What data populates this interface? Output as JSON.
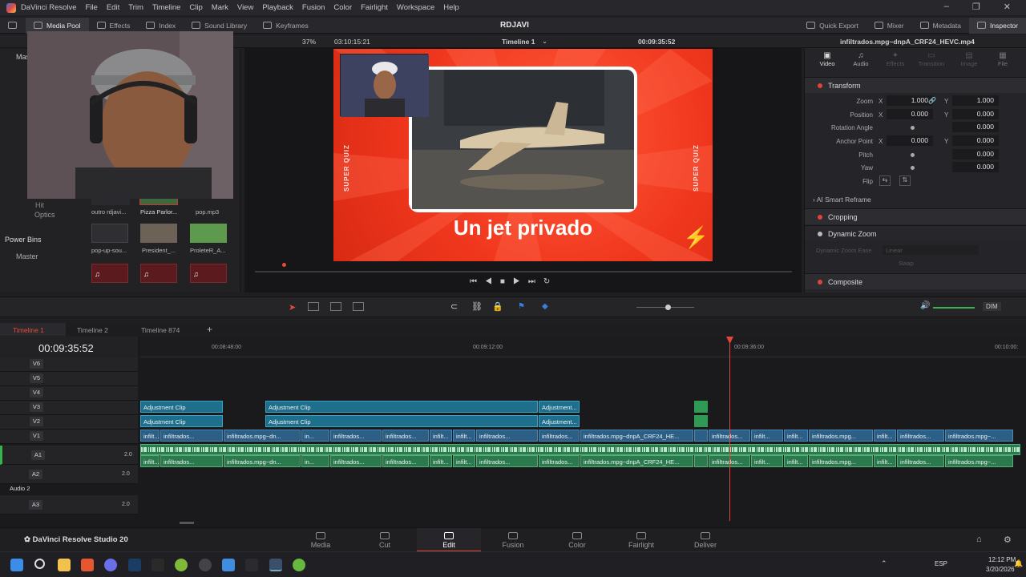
{
  "app": {
    "menu": [
      "DaVinci Resolve",
      "File",
      "Edit",
      "Trim",
      "Timeline",
      "Clip",
      "Mark",
      "View",
      "Playback",
      "Fusion",
      "Color",
      "Fairlight",
      "Workspace",
      "Help"
    ],
    "project_title": "RDJAVI"
  },
  "toolbar": {
    "left": [
      "Media Pool",
      "Effects",
      "Index",
      "Sound Library",
      "Keyframes"
    ],
    "right": [
      "Quick Export",
      "Mixer",
      "Metadata",
      "Inspector"
    ]
  },
  "viewer": {
    "zoom": "37%",
    "source_tc": "03:10:15:21",
    "timeline_name": "Timeline 1",
    "record_tc": "00:09:35:52",
    "frame_side_text": "SUPER QUIZ",
    "frame_caption": "Un jet privado"
  },
  "media_pool": {
    "sidebar": [
      "Hit",
      "Optics"
    ],
    "power_bins_label": "Power Bins",
    "master_label": "Master",
    "clips": [
      "outro rdjavi...",
      "Pizza Parlor...",
      "pop.mp3",
      "pop-up-sou...",
      "President_...",
      "ProleteR_A..."
    ]
  },
  "inspector": {
    "clip_name": "infiltrados.mpg~dnpA_CRF24_HEVC.mp4",
    "tabs": [
      "Video",
      "Audio",
      "Effects",
      "Transition",
      "Image",
      "File"
    ],
    "transform_label": "Transform",
    "params": [
      {
        "label": "Zoom",
        "x": "1.000",
        "y": "1.000"
      },
      {
        "label": "Position",
        "x": "0.000",
        "y": "0.000"
      },
      {
        "label": "Rotation Angle",
        "v": "0.000"
      },
      {
        "label": "Anchor Point",
        "x": "0.000",
        "y": "0.000"
      },
      {
        "label": "Pitch",
        "v": "0.000"
      },
      {
        "label": "Yaw",
        "v": "0.000"
      },
      {
        "label": "Flip"
      }
    ],
    "ai_reframe": "AI Smart Reframe",
    "cropping": "Cropping",
    "dynamic_zoom": "Dynamic Zoom",
    "dz_ease_label": "Dynamic Zoom Ease",
    "dz_ease_value": "Linear",
    "swap": "Swap",
    "composite": "Composite"
  },
  "timeline": {
    "tabs": [
      "Timeline 1",
      "Timeline 2",
      "Timeline 874"
    ],
    "timecode": "00:09:35:52",
    "ruler": [
      "00:08:48:00",
      "00:09:12:00",
      "00:09:36:00",
      "00:10:00:"
    ],
    "video_tracks": [
      "V6",
      "V5",
      "V4",
      "V3",
      "V2",
      "V1"
    ],
    "audio_tracks": [
      {
        "id": "A1",
        "vol": "2.0"
      },
      {
        "id": "A2",
        "vol": "2.0"
      },
      {
        "id": "A3",
        "vol": "2.0"
      }
    ],
    "audio2_label": "Audio 2",
    "adjustment_label": "Adjustment Clip",
    "adjustment_short": "Adjustment...",
    "clip_full": "infiltrados.mpg~dnpA_CRF24_HE...",
    "clip_mid": "infiltrados.mpg~dn...",
    "clip_short": "infiltrados...",
    "clip_tiny": "infilt...",
    "clip_tail": "infiltrados.mpg~...",
    "clip_mid2": "infiltrados.mpg...",
    "clip_in": "in..."
  },
  "pages": [
    "Media",
    "Cut",
    "Edit",
    "Fusion",
    "Color",
    "Fairlight",
    "Deliver"
  ],
  "active_page": "Edit",
  "brand": "DaVinci Resolve Studio 20",
  "taskbar": {
    "lang": "ESP",
    "time": "12:12 PM",
    "date": "3/20/2026"
  },
  "colors": {
    "accent": "#e84a3c",
    "frame_bg": "#f0371d"
  }
}
